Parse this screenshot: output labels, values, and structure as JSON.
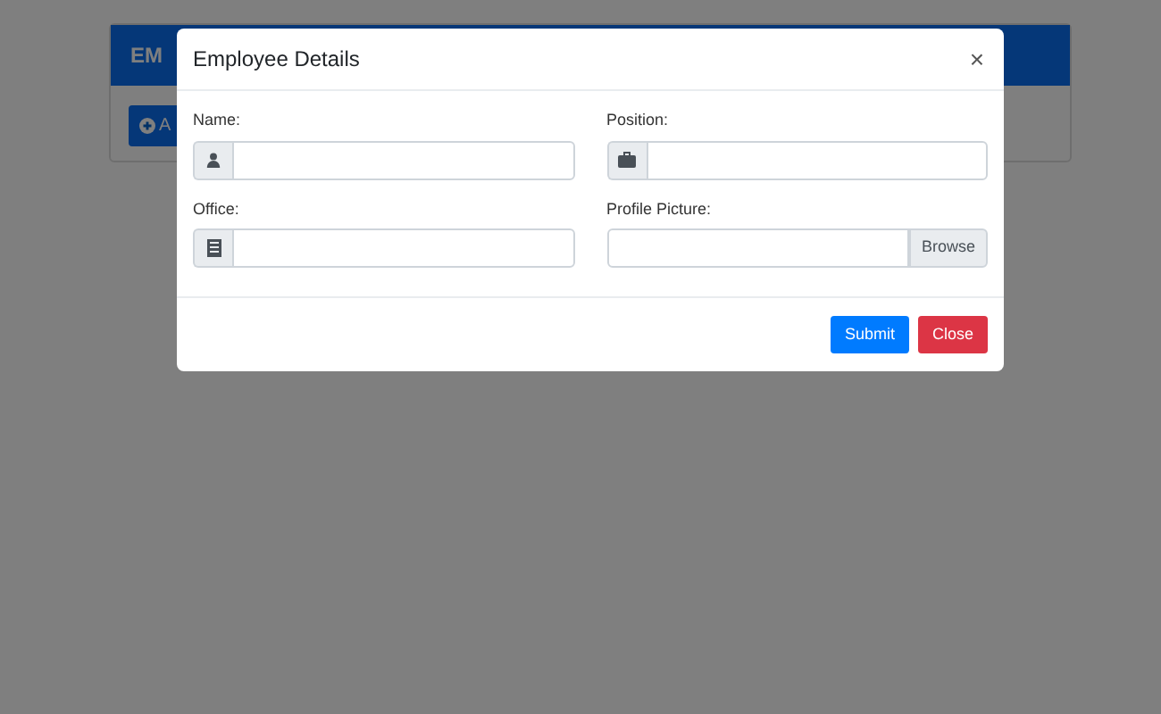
{
  "background_page": {
    "card_title": "EM",
    "add_button": "A"
  },
  "modal": {
    "title": "Employee Details",
    "close_symbol": "×",
    "fields": [
      {
        "label": "Name:",
        "kind": "text"
      },
      {
        "label": "Position:",
        "kind": "text"
      },
      {
        "label": "Office:",
        "kind": "text"
      },
      {
        "label": "Profile Picture:",
        "kind": "file",
        "button": "Browse"
      }
    ],
    "buttons": [
      {
        "label": "Submit",
        "kind": "primary"
      },
      {
        "label": "Close",
        "kind": "danger"
      }
    ]
  }
}
